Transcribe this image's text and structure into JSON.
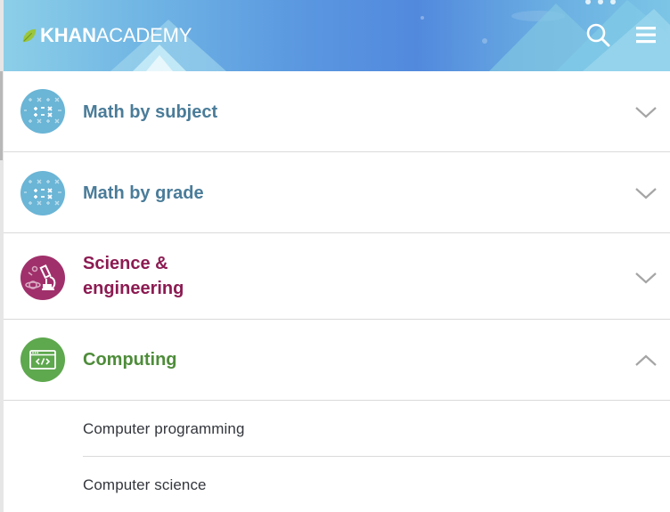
{
  "header": {
    "logo": {
      "bold": "KHAN",
      "light": "ACADEMY"
    },
    "search_icon": "search-icon",
    "menu_icon": "hamburger-menu-icon"
  },
  "domains": [
    {
      "label": "Math by subject",
      "color": "#4a7c99",
      "icon": "math-symbols-icon",
      "expanded": false
    },
    {
      "label": "Math by grade",
      "color": "#4a7c99",
      "icon": "math-symbols-icon",
      "expanded": false
    },
    {
      "label_line1": "Science &",
      "label_line2": "engineering",
      "color": "#8c1b52",
      "icon": "science-microscope-icon",
      "expanded": false
    },
    {
      "label": "Computing",
      "color": "#4e8c3a",
      "icon": "code-window-icon",
      "expanded": true,
      "children": [
        "Computer programming",
        "Computer science"
      ]
    }
  ],
  "colors": {
    "math_icon_bg": "#6bb5d6",
    "science_icon_bg": "#a0306b",
    "computing_icon_bg": "#5ea84e",
    "divider": "#dadada"
  }
}
